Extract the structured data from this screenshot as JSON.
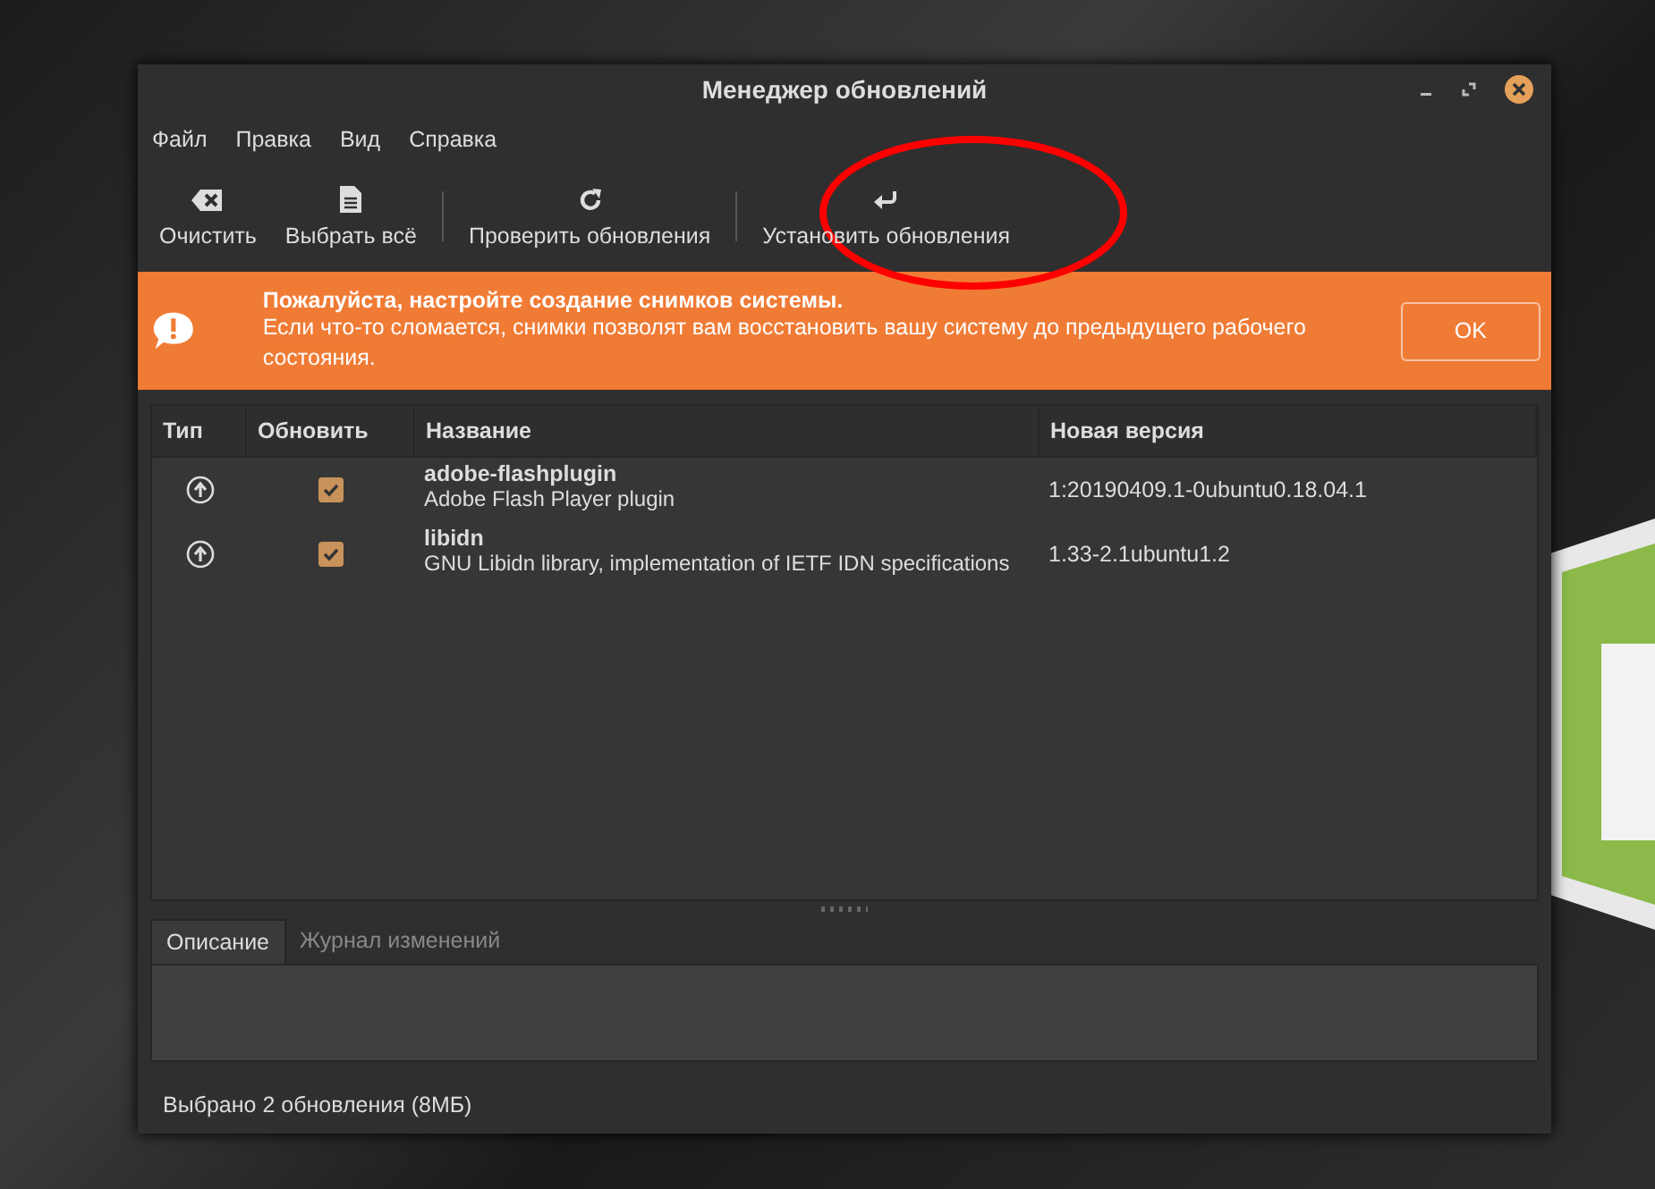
{
  "window": {
    "title": "Менеджер обновлений"
  },
  "menu": [
    "Файл",
    "Правка",
    "Вид",
    "Справка"
  ],
  "toolbar": [
    {
      "kind": "clear",
      "label": "Очистить",
      "separator_before": false
    },
    {
      "kind": "select-all",
      "label": "Выбрать всё",
      "separator_before": false
    },
    {
      "kind": "refresh",
      "label": "Проверить обновления",
      "separator_before": true
    },
    {
      "kind": "install",
      "label": "Установить обновления",
      "separator_before": true
    }
  ],
  "banner": {
    "title": "Пожалуйста, настройте создание снимков системы.",
    "text": "Если что-то сломается, снимки позволят вам восстановить вашу систему до предыдущего рабочего состояния.",
    "button": "OK"
  },
  "table": {
    "columns": [
      "Тип",
      "Обновить",
      "Название",
      "Новая версия"
    ],
    "rows": [
      {
        "checked": true,
        "name": "adobe-flashplugin",
        "description": "Adobe Flash Player plugin",
        "version": "1:20190409.1-0ubuntu0.18.04.1"
      },
      {
        "checked": true,
        "name": "libidn",
        "description": "GNU Libidn library, implementation of IETF IDN specifications",
        "version": "1.33-2.1ubuntu1.2"
      }
    ]
  },
  "tabs": [
    {
      "label": "Описание",
      "selected": true
    },
    {
      "label": "Журнал изменений",
      "selected": false
    }
  ],
  "status_bar": "Выбрано 2 обновления (8МБ)"
}
